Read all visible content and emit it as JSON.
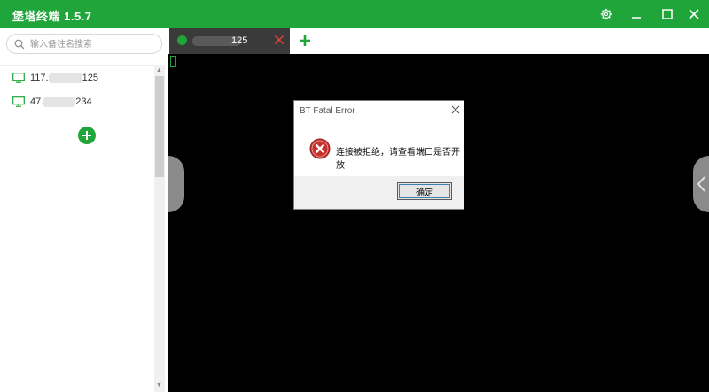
{
  "window": {
    "title": "堡塔终端 1.5.7",
    "accent": "#20a53a",
    "controls": {
      "settings_icon": "gear-icon",
      "minimize_icon": "minimize-icon",
      "maximize_icon": "maximize-icon",
      "close_icon": "close-icon"
    }
  },
  "sidebar": {
    "search": {
      "placeholder": "输入备注名搜索",
      "value": ""
    },
    "hosts": [
      {
        "label_start": "117.",
        "label_end": "125",
        "icon": "monitor-icon"
      },
      {
        "label_start": "47.",
        "label_end": "234",
        "icon": "monitor-icon"
      }
    ],
    "add_icon": "add-circle-icon"
  },
  "tabs": [
    {
      "label_end": "125",
      "status_color": "#20a53a",
      "close_icon": "close-icon"
    }
  ],
  "add_tab_icon": "plus-icon",
  "terminal": {
    "background": "#000000",
    "cursor_color": "#20a53a"
  },
  "dialog": {
    "title": "BT Fatal Error",
    "message": "连接被拒绝，请查看端口是否开放",
    "ok_label": "确定",
    "icon": "error-icon"
  }
}
